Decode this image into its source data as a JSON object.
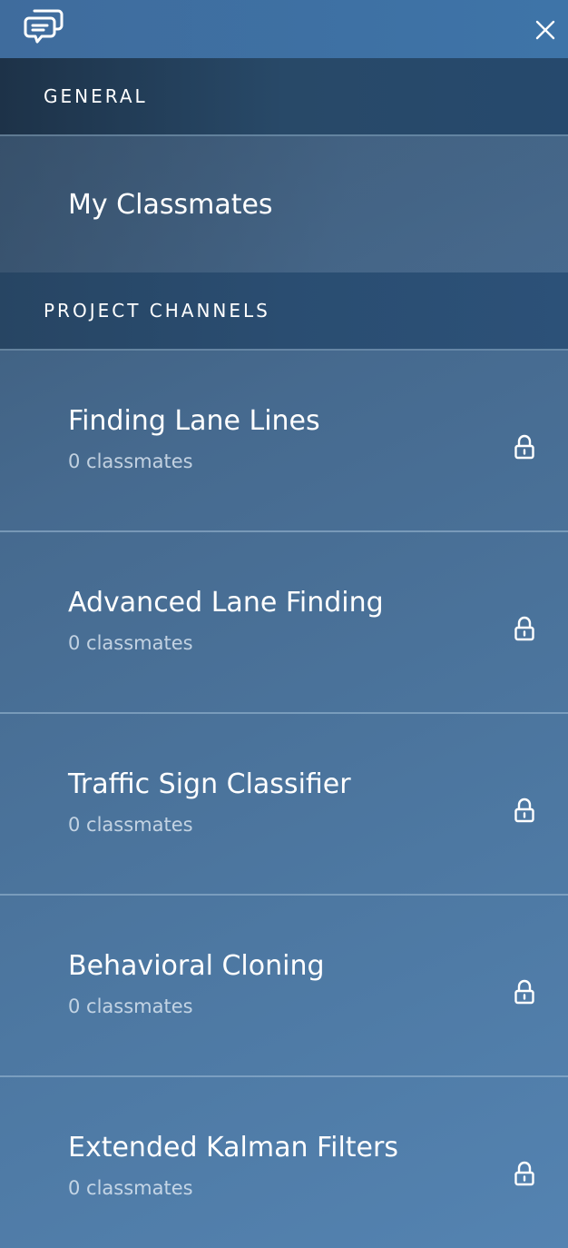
{
  "sections": {
    "general": {
      "title": "GENERAL",
      "items": [
        {
          "label": "My Classmates"
        }
      ]
    },
    "projects": {
      "title": "PROJECT CHANNELS",
      "channels": [
        {
          "title": "Finding Lane Lines",
          "subtitle": "0 classmates"
        },
        {
          "title": "Advanced Lane Finding",
          "subtitle": "0 classmates"
        },
        {
          "title": "Traffic Sign Classifier",
          "subtitle": "0 classmates"
        },
        {
          "title": "Behavioral Cloning",
          "subtitle": "0 classmates"
        },
        {
          "title": "Extended Kalman Filters",
          "subtitle": "0 classmates"
        }
      ]
    }
  },
  "icons": {
    "logo": "chat-bubbles-icon",
    "close": "close-icon",
    "lock": "lock-icon"
  },
  "colors": {
    "topbar": "#3e6fa2",
    "section_header": "#26486a",
    "text": "#ffffff"
  }
}
